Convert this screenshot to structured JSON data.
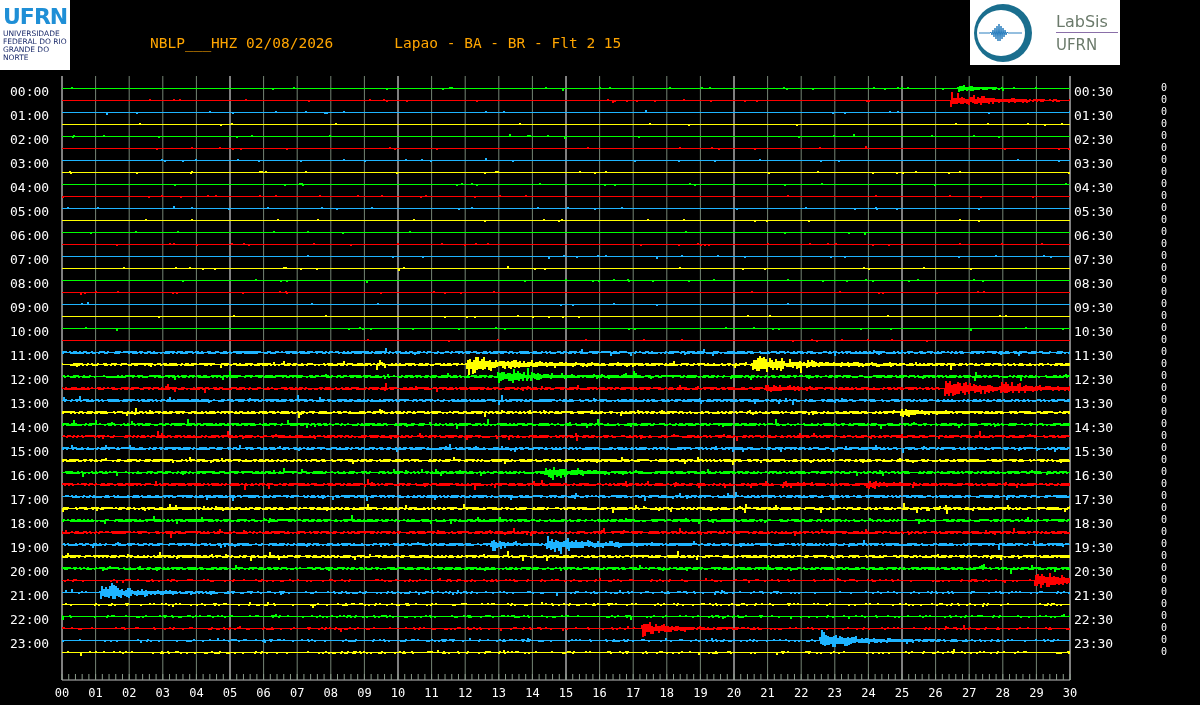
{
  "header": {
    "ufrn_logo": {
      "letters": "UFRN",
      "caption": "UNIVERSIDADE FEDERAL DO RIO GRANDE DO NORTE"
    },
    "station": "NBLP___HHZ 02/08/2026",
    "location": "Lapao - BA - BR - Flt 2 15",
    "labsis_logo": {
      "name": "LabSis",
      "org": "UFRN"
    }
  },
  "helicorder": {
    "hours": [
      {
        "left": "00:00",
        "right": "00:30",
        "traces": [
          {
            "color": "#00ff00",
            "value": "0"
          },
          {
            "color": "#ff0000",
            "value": "0"
          }
        ]
      },
      {
        "left": "01:00",
        "right": "01:30",
        "traces": [
          {
            "color": "#1eb4ff",
            "value": "0"
          },
          {
            "color": "#ffff00",
            "value": "0"
          }
        ]
      },
      {
        "left": "02:00",
        "right": "02:30",
        "traces": [
          {
            "color": "#00ff00",
            "value": "0"
          },
          {
            "color": "#ff0000",
            "value": "0"
          }
        ]
      },
      {
        "left": "03:00",
        "right": "03:30",
        "traces": [
          {
            "color": "#1eb4ff",
            "value": "0"
          },
          {
            "color": "#ffff00",
            "value": "0"
          }
        ]
      },
      {
        "left": "04:00",
        "right": "04:30",
        "traces": [
          {
            "color": "#00ff00",
            "value": "0"
          },
          {
            "color": "#ff0000",
            "value": "0"
          }
        ]
      },
      {
        "left": "05:00",
        "right": "05:30",
        "traces": [
          {
            "color": "#1eb4ff",
            "value": "0"
          },
          {
            "color": "#ffff00",
            "value": "0"
          }
        ]
      },
      {
        "left": "06:00",
        "right": "06:30",
        "traces": [
          {
            "color": "#00ff00",
            "value": "0"
          },
          {
            "color": "#ff0000",
            "value": "0"
          }
        ]
      },
      {
        "left": "07:00",
        "right": "07:30",
        "traces": [
          {
            "color": "#1eb4ff",
            "value": "0"
          },
          {
            "color": "#ffff00",
            "value": "0"
          }
        ]
      },
      {
        "left": "08:00",
        "right": "08:30",
        "traces": [
          {
            "color": "#00ff00",
            "value": "0"
          },
          {
            "color": "#ff0000",
            "value": "0"
          }
        ]
      },
      {
        "left": "09:00",
        "right": "09:30",
        "traces": [
          {
            "color": "#1eb4ff",
            "value": "0"
          },
          {
            "color": "#ffff00",
            "value": "0"
          }
        ]
      },
      {
        "left": "10:00",
        "right": "10:30",
        "traces": [
          {
            "color": "#00ff00",
            "value": "0"
          },
          {
            "color": "#ff0000",
            "value": "0"
          }
        ]
      },
      {
        "left": "11:00",
        "right": "11:30",
        "traces": [
          {
            "color": "#1eb4ff",
            "value": "0"
          },
          {
            "color": "#ffff00",
            "value": "0"
          }
        ]
      },
      {
        "left": "12:00",
        "right": "12:30",
        "traces": [
          {
            "color": "#00ff00",
            "value": "0"
          },
          {
            "color": "#ff0000",
            "value": "0"
          }
        ]
      },
      {
        "left": "13:00",
        "right": "13:30",
        "traces": [
          {
            "color": "#1eb4ff",
            "value": "0"
          },
          {
            "color": "#ffff00",
            "value": "0"
          }
        ]
      },
      {
        "left": "14:00",
        "right": "14:30",
        "traces": [
          {
            "color": "#00ff00",
            "value": "0"
          },
          {
            "color": "#ff0000",
            "value": "0"
          }
        ]
      },
      {
        "left": "15:00",
        "right": "15:30",
        "traces": [
          {
            "color": "#1eb4ff",
            "value": "0"
          },
          {
            "color": "#ffff00",
            "value": "0"
          }
        ]
      },
      {
        "left": "16:00",
        "right": "16:30",
        "traces": [
          {
            "color": "#00ff00",
            "value": "0"
          },
          {
            "color": "#ff0000",
            "value": "0"
          }
        ]
      },
      {
        "left": "17:00",
        "right": "17:30",
        "traces": [
          {
            "color": "#1eb4ff",
            "value": "0"
          },
          {
            "color": "#ffff00",
            "value": "0"
          }
        ]
      },
      {
        "left": "18:00",
        "right": "18:30",
        "traces": [
          {
            "color": "#00ff00",
            "value": "0"
          },
          {
            "color": "#ff0000",
            "value": "0"
          }
        ]
      },
      {
        "left": "19:00",
        "right": "19:30",
        "traces": [
          {
            "color": "#1eb4ff",
            "value": "0"
          },
          {
            "color": "#ffff00",
            "value": "0"
          }
        ]
      },
      {
        "left": "20:00",
        "right": "20:30",
        "traces": [
          {
            "color": "#00ff00",
            "value": "0"
          },
          {
            "color": "#ff0000",
            "value": "0"
          }
        ]
      },
      {
        "left": "21:00",
        "right": "21:30",
        "traces": [
          {
            "color": "#1eb4ff",
            "value": "0"
          },
          {
            "color": "#ffff00",
            "value": "0"
          }
        ]
      },
      {
        "left": "22:00",
        "right": "22:30",
        "traces": [
          {
            "color": "#00ff00",
            "value": "0"
          },
          {
            "color": "#ff0000",
            "value": "0"
          }
        ]
      },
      {
        "left": "23:00",
        "right": "23:30",
        "traces": [
          {
            "color": "#1eb4ff",
            "value": "0"
          },
          {
            "color": "#ffff00",
            "value": "0"
          }
        ]
      }
    ],
    "x_axis": [
      "00",
      "01",
      "02",
      "03",
      "04",
      "05",
      "06",
      "07",
      "08",
      "09",
      "10",
      "11",
      "12",
      "13",
      "14",
      "15",
      "16",
      "17",
      "18",
      "19",
      "20",
      "21",
      "22",
      "23",
      "24",
      "25",
      "26",
      "27",
      "28",
      "29",
      "30"
    ]
  }
}
